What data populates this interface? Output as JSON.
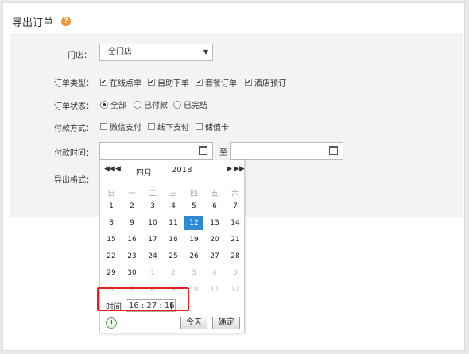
{
  "title": "导出订单",
  "help": "?",
  "store": {
    "label": "门店：",
    "value": "全门店"
  },
  "order_type": {
    "label": "订单类型：",
    "options": [
      {
        "text": "在线点单",
        "checked": true
      },
      {
        "text": "自助下单",
        "checked": true
      },
      {
        "text": "套餐订单",
        "checked": true
      },
      {
        "text": "酒店预订",
        "checked": true
      }
    ]
  },
  "order_status": {
    "label": "订单状态：",
    "options": [
      {
        "text": "全部",
        "checked": true
      },
      {
        "text": "已付款",
        "checked": false
      },
      {
        "text": "已完结",
        "checked": false
      }
    ]
  },
  "payment_method": {
    "label": "付款方式：",
    "options": [
      {
        "text": "微信支付",
        "checked": false
      },
      {
        "text": "线下支付",
        "checked": false
      },
      {
        "text": "储值卡",
        "checked": false
      }
    ]
  },
  "payment_time": {
    "label": "付款时间：",
    "to": "至"
  },
  "export_format": {
    "label": "导出格式："
  },
  "calendar": {
    "nav": {
      "prev_year": "◀◀",
      "prev_month": "◀",
      "next_month": "▶",
      "next_year": "▶▶"
    },
    "month": "四月",
    "year": "2018",
    "weekdays": [
      "日",
      "一",
      "二",
      "三",
      "四",
      "五",
      "六"
    ],
    "weeks": [
      [
        "1",
        "2",
        "3",
        "4",
        "5",
        "6",
        "7"
      ],
      [
        "8",
        "9",
        "10",
        "11",
        "12",
        "13",
        "14"
      ],
      [
        "15",
        "16",
        "17",
        "18",
        "19",
        "20",
        "21"
      ],
      [
        "22",
        "23",
        "24",
        "25",
        "26",
        "27",
        "28"
      ],
      [
        "29",
        "30",
        "1",
        "2",
        "3",
        "4",
        "5"
      ],
      [
        "6",
        "7",
        "8",
        "9",
        "10",
        "11",
        "12"
      ]
    ],
    "selected": "12",
    "time_label": "时间",
    "time_value": "16 : 27 : 16",
    "today": "今天",
    "confirm": "确定"
  }
}
